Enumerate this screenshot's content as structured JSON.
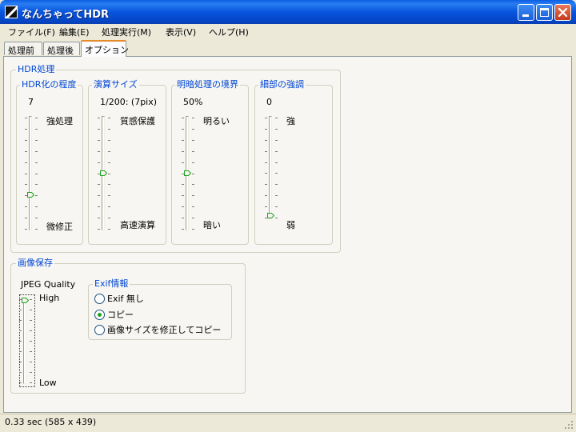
{
  "window": {
    "title": "なんちゃってHDR",
    "controls": [
      "minimize-icon",
      "maximize-icon",
      "close-icon"
    ]
  },
  "menu": [
    "ファイル(F)",
    "編集(E)",
    "処理実行(M)",
    "表示(V)",
    "ヘルプ(H)"
  ],
  "tabs": [
    {
      "label": "処理前",
      "active": false
    },
    {
      "label": "処理後",
      "active": false
    },
    {
      "label": "オプション",
      "active": true
    }
  ],
  "hdr": {
    "title": "HDR処理",
    "degree": {
      "title": "HDR化の程度",
      "value": "7",
      "top_label": "強処理",
      "bottom_label": "微修正",
      "level": 0.3
    },
    "calc_size": {
      "title": "演算サイズ",
      "value": "1/200: (7pix)",
      "top_label": "質感保護",
      "bottom_label": "高速演算",
      "level": 0.5
    },
    "light_dark": {
      "title": "明暗処理の境界",
      "value": "50%",
      "top_label": "明るい",
      "bottom_label": "暗い",
      "level": 0.5
    },
    "detail": {
      "title": "細部の強調",
      "value": "0",
      "top_label": "強",
      "bottom_label": "弱",
      "level": 0.0
    }
  },
  "save": {
    "title": "画像保存",
    "jpeg": {
      "title": "JPEG Quality",
      "top_label": "High",
      "bottom_label": "Low",
      "level": 1.0
    },
    "exif": {
      "title": "Exif情報",
      "options": [
        {
          "label": "Exif 無し",
          "checked": false
        },
        {
          "label": "コピー",
          "checked": true
        },
        {
          "label": "画像サイズを修正してコピー",
          "checked": false
        }
      ]
    }
  },
  "status": {
    "text": "0.33 sec (585 x 439)"
  },
  "colors": {
    "title_bar": "#0855dd",
    "group_title": "#0046d5",
    "tab_highlight": "#e68b2c",
    "thumb": "#21a121"
  }
}
